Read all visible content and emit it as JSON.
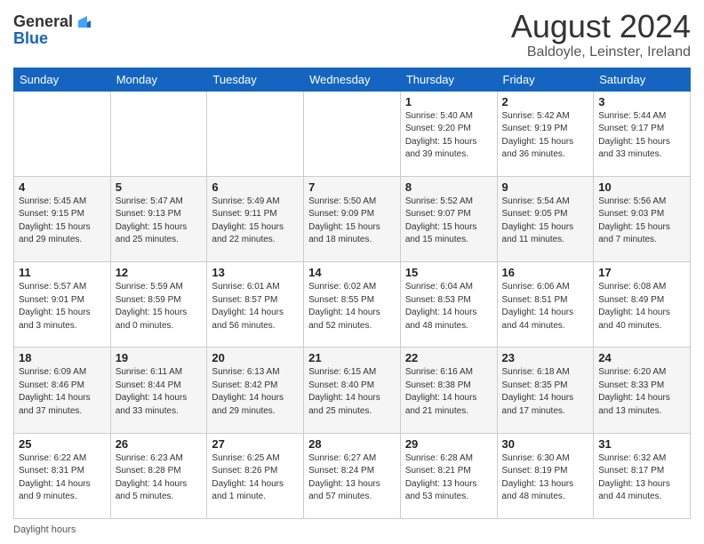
{
  "header": {
    "logo": {
      "line1": "General",
      "line2": "Blue"
    },
    "title": "August 2024",
    "subtitle": "Baldoyle, Leinster, Ireland"
  },
  "calendar": {
    "days_of_week": [
      "Sunday",
      "Monday",
      "Tuesday",
      "Wednesday",
      "Thursday",
      "Friday",
      "Saturday"
    ],
    "weeks": [
      [
        {
          "day": "",
          "info": ""
        },
        {
          "day": "",
          "info": ""
        },
        {
          "day": "",
          "info": ""
        },
        {
          "day": "",
          "info": ""
        },
        {
          "day": "1",
          "info": "Sunrise: 5:40 AM\nSunset: 9:20 PM\nDaylight: 15 hours\nand 39 minutes."
        },
        {
          "day": "2",
          "info": "Sunrise: 5:42 AM\nSunset: 9:19 PM\nDaylight: 15 hours\nand 36 minutes."
        },
        {
          "day": "3",
          "info": "Sunrise: 5:44 AM\nSunset: 9:17 PM\nDaylight: 15 hours\nand 33 minutes."
        }
      ],
      [
        {
          "day": "4",
          "info": "Sunrise: 5:45 AM\nSunset: 9:15 PM\nDaylight: 15 hours\nand 29 minutes."
        },
        {
          "day": "5",
          "info": "Sunrise: 5:47 AM\nSunset: 9:13 PM\nDaylight: 15 hours\nand 25 minutes."
        },
        {
          "day": "6",
          "info": "Sunrise: 5:49 AM\nSunset: 9:11 PM\nDaylight: 15 hours\nand 22 minutes."
        },
        {
          "day": "7",
          "info": "Sunrise: 5:50 AM\nSunset: 9:09 PM\nDaylight: 15 hours\nand 18 minutes."
        },
        {
          "day": "8",
          "info": "Sunrise: 5:52 AM\nSunset: 9:07 PM\nDaylight: 15 hours\nand 15 minutes."
        },
        {
          "day": "9",
          "info": "Sunrise: 5:54 AM\nSunset: 9:05 PM\nDaylight: 15 hours\nand 11 minutes."
        },
        {
          "day": "10",
          "info": "Sunrise: 5:56 AM\nSunset: 9:03 PM\nDaylight: 15 hours\nand 7 minutes."
        }
      ],
      [
        {
          "day": "11",
          "info": "Sunrise: 5:57 AM\nSunset: 9:01 PM\nDaylight: 15 hours\nand 3 minutes."
        },
        {
          "day": "12",
          "info": "Sunrise: 5:59 AM\nSunset: 8:59 PM\nDaylight: 15 hours\nand 0 minutes."
        },
        {
          "day": "13",
          "info": "Sunrise: 6:01 AM\nSunset: 8:57 PM\nDaylight: 14 hours\nand 56 minutes."
        },
        {
          "day": "14",
          "info": "Sunrise: 6:02 AM\nSunset: 8:55 PM\nDaylight: 14 hours\nand 52 minutes."
        },
        {
          "day": "15",
          "info": "Sunrise: 6:04 AM\nSunset: 8:53 PM\nDaylight: 14 hours\nand 48 minutes."
        },
        {
          "day": "16",
          "info": "Sunrise: 6:06 AM\nSunset: 8:51 PM\nDaylight: 14 hours\nand 44 minutes."
        },
        {
          "day": "17",
          "info": "Sunrise: 6:08 AM\nSunset: 8:49 PM\nDaylight: 14 hours\nand 40 minutes."
        }
      ],
      [
        {
          "day": "18",
          "info": "Sunrise: 6:09 AM\nSunset: 8:46 PM\nDaylight: 14 hours\nand 37 minutes."
        },
        {
          "day": "19",
          "info": "Sunrise: 6:11 AM\nSunset: 8:44 PM\nDaylight: 14 hours\nand 33 minutes."
        },
        {
          "day": "20",
          "info": "Sunrise: 6:13 AM\nSunset: 8:42 PM\nDaylight: 14 hours\nand 29 minutes."
        },
        {
          "day": "21",
          "info": "Sunrise: 6:15 AM\nSunset: 8:40 PM\nDaylight: 14 hours\nand 25 minutes."
        },
        {
          "day": "22",
          "info": "Sunrise: 6:16 AM\nSunset: 8:38 PM\nDaylight: 14 hours\nand 21 minutes."
        },
        {
          "day": "23",
          "info": "Sunrise: 6:18 AM\nSunset: 8:35 PM\nDaylight: 14 hours\nand 17 minutes."
        },
        {
          "day": "24",
          "info": "Sunrise: 6:20 AM\nSunset: 8:33 PM\nDaylight: 14 hours\nand 13 minutes."
        }
      ],
      [
        {
          "day": "25",
          "info": "Sunrise: 6:22 AM\nSunset: 8:31 PM\nDaylight: 14 hours\nand 9 minutes."
        },
        {
          "day": "26",
          "info": "Sunrise: 6:23 AM\nSunset: 8:28 PM\nDaylight: 14 hours\nand 5 minutes."
        },
        {
          "day": "27",
          "info": "Sunrise: 6:25 AM\nSunset: 8:26 PM\nDaylight: 14 hours\nand 1 minute."
        },
        {
          "day": "28",
          "info": "Sunrise: 6:27 AM\nSunset: 8:24 PM\nDaylight: 13 hours\nand 57 minutes."
        },
        {
          "day": "29",
          "info": "Sunrise: 6:28 AM\nSunset: 8:21 PM\nDaylight: 13 hours\nand 53 minutes."
        },
        {
          "day": "30",
          "info": "Sunrise: 6:30 AM\nSunset: 8:19 PM\nDaylight: 13 hours\nand 48 minutes."
        },
        {
          "day": "31",
          "info": "Sunrise: 6:32 AM\nSunset: 8:17 PM\nDaylight: 13 hours\nand 44 minutes."
        }
      ]
    ]
  },
  "footer": {
    "daylight_label": "Daylight hours"
  }
}
